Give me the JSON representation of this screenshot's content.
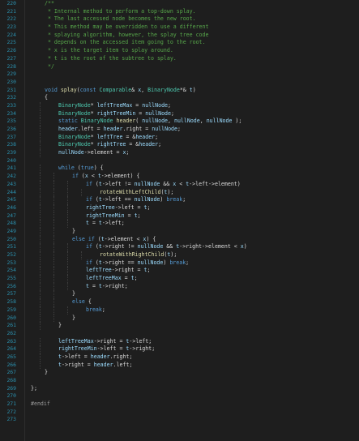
{
  "editor": {
    "first_line_number": 220,
    "colors": {
      "background": "#1e1e1e",
      "line_number": "#2b91af",
      "comment": "#57a64a",
      "keyword": "#569cd6",
      "type": "#4ec9b0",
      "function": "#dcdcaa",
      "variable": "#9cdcfe",
      "plain": "#dcdcdc"
    },
    "lines": [
      {
        "num": "220",
        "indent": 1,
        "tokens": [
          [
            "comment",
            "/**"
          ]
        ]
      },
      {
        "num": "221",
        "indent": 1,
        "tokens": [
          [
            "comment",
            " * Internal method to perform a top-down splay."
          ]
        ]
      },
      {
        "num": "222",
        "indent": 1,
        "tokens": [
          [
            "comment",
            " * The last accessed node becomes the new root."
          ]
        ]
      },
      {
        "num": "223",
        "indent": 1,
        "tokens": [
          [
            "comment",
            " * This method may be overridden to use a different"
          ]
        ]
      },
      {
        "num": "224",
        "indent": 1,
        "tokens": [
          [
            "comment",
            " * splaying algorithm, however, the splay tree code"
          ]
        ]
      },
      {
        "num": "225",
        "indent": 1,
        "tokens": [
          [
            "comment",
            " * depends on the accessed item going to the root."
          ]
        ]
      },
      {
        "num": "226",
        "indent": 1,
        "tokens": [
          [
            "comment",
            " * x is the target item to splay around."
          ]
        ]
      },
      {
        "num": "227",
        "indent": 1,
        "tokens": [
          [
            "comment",
            " * t is the root of the subtree to splay."
          ]
        ]
      },
      {
        "num": "228",
        "indent": 1,
        "tokens": [
          [
            "comment",
            " */"
          ]
        ]
      },
      {
        "num": "229",
        "indent": 0,
        "tokens": []
      },
      {
        "num": "230",
        "indent": 0,
        "tokens": []
      },
      {
        "num": "231",
        "indent": 1,
        "tokens": [
          [
            "keyword",
            "void "
          ],
          [
            "func",
            "splay"
          ],
          [
            "plain",
            "("
          ],
          [
            "keyword",
            "const "
          ],
          [
            "type",
            "Comparable"
          ],
          [
            "plain",
            "& "
          ],
          [
            "var",
            "x"
          ],
          [
            "plain",
            ", "
          ],
          [
            "type",
            "BinaryNode"
          ],
          [
            "plain",
            "*& "
          ],
          [
            "var",
            "t"
          ],
          [
            "plain",
            ")"
          ]
        ]
      },
      {
        "num": "232",
        "indent": 1,
        "tokens": [
          [
            "plain",
            "{"
          ]
        ]
      },
      {
        "num": "233",
        "indent": 2,
        "tokens": [
          [
            "type",
            "BinaryNode"
          ],
          [
            "plain",
            "* "
          ],
          [
            "var",
            "leftTreeMax"
          ],
          [
            "plain",
            " = "
          ],
          [
            "var",
            "nullNode"
          ],
          [
            "plain",
            ";"
          ]
        ]
      },
      {
        "num": "234",
        "indent": 2,
        "tokens": [
          [
            "type",
            "BinaryNode"
          ],
          [
            "plain",
            "* "
          ],
          [
            "var",
            "rightTreeMin"
          ],
          [
            "plain",
            " = "
          ],
          [
            "var",
            "nullNode"
          ],
          [
            "plain",
            ";"
          ]
        ]
      },
      {
        "num": "235",
        "indent": 2,
        "tokens": [
          [
            "keyword",
            "static "
          ],
          [
            "type",
            "BinaryNode "
          ],
          [
            "func",
            "header"
          ],
          [
            "plain",
            "( "
          ],
          [
            "var",
            "nullNode"
          ],
          [
            "plain",
            ", "
          ],
          [
            "var",
            "nullNode"
          ],
          [
            "plain",
            ", "
          ],
          [
            "var",
            "nullNode"
          ],
          [
            "plain",
            " );"
          ]
        ]
      },
      {
        "num": "236",
        "indent": 2,
        "tokens": [
          [
            "var",
            "header"
          ],
          [
            "plain",
            "."
          ],
          [
            "field",
            "left"
          ],
          [
            "plain",
            " = "
          ],
          [
            "var",
            "header"
          ],
          [
            "plain",
            "."
          ],
          [
            "field",
            "right"
          ],
          [
            "plain",
            " = "
          ],
          [
            "var",
            "nullNode"
          ],
          [
            "plain",
            ";"
          ]
        ]
      },
      {
        "num": "237",
        "indent": 2,
        "tokens": [
          [
            "type",
            "BinaryNode"
          ],
          [
            "plain",
            "* "
          ],
          [
            "var",
            "leftTree"
          ],
          [
            "plain",
            " = &"
          ],
          [
            "var",
            "header"
          ],
          [
            "plain",
            ";"
          ]
        ]
      },
      {
        "num": "238",
        "indent": 2,
        "tokens": [
          [
            "type",
            "BinaryNode"
          ],
          [
            "plain",
            "* "
          ],
          [
            "var",
            "rightTree"
          ],
          [
            "plain",
            " = &"
          ],
          [
            "var",
            "header"
          ],
          [
            "plain",
            ";"
          ]
        ]
      },
      {
        "num": "239",
        "indent": 2,
        "tokens": [
          [
            "var",
            "nullNode"
          ],
          [
            "plain",
            "->"
          ],
          [
            "field",
            "element"
          ],
          [
            "plain",
            " = "
          ],
          [
            "var",
            "x"
          ],
          [
            "plain",
            ";"
          ]
        ]
      },
      {
        "num": "240",
        "indent": 0,
        "tokens": []
      },
      {
        "num": "241",
        "indent": 2,
        "tokens": [
          [
            "keyword",
            "while "
          ],
          [
            "plain",
            "("
          ],
          [
            "keyword",
            "true"
          ],
          [
            "plain",
            ") {"
          ]
        ]
      },
      {
        "num": "242",
        "indent": 3,
        "tokens": [
          [
            "keyword",
            "if "
          ],
          [
            "plain",
            "("
          ],
          [
            "var",
            "x"
          ],
          [
            "plain",
            " < "
          ],
          [
            "var",
            "t"
          ],
          [
            "plain",
            "->"
          ],
          [
            "field",
            "element"
          ],
          [
            "plain",
            ") {"
          ]
        ]
      },
      {
        "num": "243",
        "indent": 4,
        "tokens": [
          [
            "keyword",
            "if "
          ],
          [
            "plain",
            "("
          ],
          [
            "var",
            "t"
          ],
          [
            "plain",
            "->"
          ],
          [
            "field",
            "left"
          ],
          [
            "plain",
            " != "
          ],
          [
            "var",
            "nullNode"
          ],
          [
            "plain",
            " && "
          ],
          [
            "var",
            "x"
          ],
          [
            "plain",
            " < "
          ],
          [
            "var",
            "t"
          ],
          [
            "plain",
            "->"
          ],
          [
            "field",
            "left"
          ],
          [
            "plain",
            "->"
          ],
          [
            "field",
            "element"
          ],
          [
            "plain",
            ")"
          ]
        ]
      },
      {
        "num": "244",
        "indent": 5,
        "tokens": [
          [
            "func",
            "rotateWithLeftChild"
          ],
          [
            "plain",
            "("
          ],
          [
            "var",
            "t"
          ],
          [
            "plain",
            ");"
          ]
        ]
      },
      {
        "num": "245",
        "indent": 4,
        "tokens": [
          [
            "keyword",
            "if "
          ],
          [
            "plain",
            "("
          ],
          [
            "var",
            "t"
          ],
          [
            "plain",
            "->"
          ],
          [
            "field",
            "left"
          ],
          [
            "plain",
            " == "
          ],
          [
            "var",
            "nullNode"
          ],
          [
            "plain",
            ") "
          ],
          [
            "keyword",
            "break"
          ],
          [
            "plain",
            ";"
          ]
        ]
      },
      {
        "num": "246",
        "indent": 4,
        "tokens": [
          [
            "var",
            "rightTree"
          ],
          [
            "plain",
            "->"
          ],
          [
            "field",
            "left"
          ],
          [
            "plain",
            " = "
          ],
          [
            "var",
            "t"
          ],
          [
            "plain",
            ";"
          ]
        ]
      },
      {
        "num": "247",
        "indent": 4,
        "tokens": [
          [
            "var",
            "rightTreeMin"
          ],
          [
            "plain",
            " = "
          ],
          [
            "var",
            "t"
          ],
          [
            "plain",
            ";"
          ]
        ]
      },
      {
        "num": "248",
        "indent": 4,
        "tokens": [
          [
            "var",
            "t"
          ],
          [
            "plain",
            " = "
          ],
          [
            "var",
            "t"
          ],
          [
            "plain",
            "->"
          ],
          [
            "field",
            "left"
          ],
          [
            "plain",
            ";"
          ]
        ]
      },
      {
        "num": "249",
        "indent": 3,
        "tokens": [
          [
            "plain",
            "}"
          ]
        ]
      },
      {
        "num": "250",
        "indent": 3,
        "tokens": [
          [
            "keyword",
            "else if "
          ],
          [
            "plain",
            "("
          ],
          [
            "var",
            "t"
          ],
          [
            "plain",
            "->"
          ],
          [
            "field",
            "element"
          ],
          [
            "plain",
            " < "
          ],
          [
            "var",
            "x"
          ],
          [
            "plain",
            ") {"
          ]
        ]
      },
      {
        "num": "251",
        "indent": 4,
        "tokens": [
          [
            "keyword",
            "if "
          ],
          [
            "plain",
            "("
          ],
          [
            "var",
            "t"
          ],
          [
            "plain",
            "->"
          ],
          [
            "field",
            "right"
          ],
          [
            "plain",
            " != "
          ],
          [
            "var",
            "nullNode"
          ],
          [
            "plain",
            " && "
          ],
          [
            "var",
            "t"
          ],
          [
            "plain",
            "->"
          ],
          [
            "field",
            "right"
          ],
          [
            "plain",
            "->"
          ],
          [
            "field",
            "element"
          ],
          [
            "plain",
            " < "
          ],
          [
            "var",
            "x"
          ],
          [
            "plain",
            ")"
          ]
        ]
      },
      {
        "num": "252",
        "indent": 5,
        "tokens": [
          [
            "func",
            "rotateWithRightChild"
          ],
          [
            "plain",
            "("
          ],
          [
            "var",
            "t"
          ],
          [
            "plain",
            ");"
          ]
        ]
      },
      {
        "num": "253",
        "indent": 4,
        "tokens": [
          [
            "keyword",
            "if "
          ],
          [
            "plain",
            "("
          ],
          [
            "var",
            "t"
          ],
          [
            "plain",
            "->"
          ],
          [
            "field",
            "right"
          ],
          [
            "plain",
            " == "
          ],
          [
            "var",
            "nullNode"
          ],
          [
            "plain",
            ") "
          ],
          [
            "keyword",
            "break"
          ],
          [
            "plain",
            ";"
          ]
        ]
      },
      {
        "num": "254",
        "indent": 4,
        "tokens": [
          [
            "var",
            "leftTree"
          ],
          [
            "plain",
            "->"
          ],
          [
            "field",
            "right"
          ],
          [
            "plain",
            " = "
          ],
          [
            "var",
            "t"
          ],
          [
            "plain",
            ";"
          ]
        ]
      },
      {
        "num": "255",
        "indent": 4,
        "tokens": [
          [
            "var",
            "leftTreeMax"
          ],
          [
            "plain",
            " = "
          ],
          [
            "var",
            "t"
          ],
          [
            "plain",
            ";"
          ]
        ]
      },
      {
        "num": "256",
        "indent": 4,
        "tokens": [
          [
            "var",
            "t"
          ],
          [
            "plain",
            " = "
          ],
          [
            "var",
            "t"
          ],
          [
            "plain",
            "->"
          ],
          [
            "field",
            "right"
          ],
          [
            "plain",
            ";"
          ]
        ]
      },
      {
        "num": "257",
        "indent": 3,
        "tokens": [
          [
            "plain",
            "}"
          ]
        ]
      },
      {
        "num": "258",
        "indent": 3,
        "tokens": [
          [
            "keyword",
            "else "
          ],
          [
            "plain",
            "{"
          ]
        ]
      },
      {
        "num": "259",
        "indent": 4,
        "tokens": [
          [
            "keyword",
            "break"
          ],
          [
            "plain",
            ";"
          ]
        ]
      },
      {
        "num": "260",
        "indent": 3,
        "tokens": [
          [
            "plain",
            "}"
          ]
        ]
      },
      {
        "num": "261",
        "indent": 2,
        "tokens": [
          [
            "plain",
            "}"
          ]
        ]
      },
      {
        "num": "262",
        "indent": 0,
        "tokens": []
      },
      {
        "num": "263",
        "indent": 2,
        "tokens": [
          [
            "var",
            "leftTreeMax"
          ],
          [
            "plain",
            "->"
          ],
          [
            "field",
            "right"
          ],
          [
            "plain",
            " = "
          ],
          [
            "var",
            "t"
          ],
          [
            "plain",
            "->"
          ],
          [
            "field",
            "left"
          ],
          [
            "plain",
            ";"
          ]
        ]
      },
      {
        "num": "264",
        "indent": 2,
        "tokens": [
          [
            "var",
            "rightTreeMin"
          ],
          [
            "plain",
            "->"
          ],
          [
            "field",
            "left"
          ],
          [
            "plain",
            " = "
          ],
          [
            "var",
            "t"
          ],
          [
            "plain",
            "->"
          ],
          [
            "field",
            "right"
          ],
          [
            "plain",
            ";"
          ]
        ]
      },
      {
        "num": "265",
        "indent": 2,
        "tokens": [
          [
            "var",
            "t"
          ],
          [
            "plain",
            "->"
          ],
          [
            "field",
            "left"
          ],
          [
            "plain",
            " = "
          ],
          [
            "var",
            "header"
          ],
          [
            "plain",
            "."
          ],
          [
            "field",
            "right"
          ],
          [
            "plain",
            ";"
          ]
        ]
      },
      {
        "num": "266",
        "indent": 2,
        "tokens": [
          [
            "var",
            "t"
          ],
          [
            "plain",
            "->"
          ],
          [
            "field",
            "right"
          ],
          [
            "plain",
            " = "
          ],
          [
            "var",
            "header"
          ],
          [
            "plain",
            "."
          ],
          [
            "field",
            "left"
          ],
          [
            "plain",
            ";"
          ]
        ]
      },
      {
        "num": "267",
        "indent": 1,
        "tokens": [
          [
            "plain",
            "}"
          ]
        ]
      },
      {
        "num": "268",
        "indent": 0,
        "tokens": []
      },
      {
        "num": "269",
        "indent": 0,
        "tokens": [
          [
            "plain",
            "};"
          ]
        ]
      },
      {
        "num": "270",
        "indent": 0,
        "tokens": []
      },
      {
        "num": "271",
        "indent": 0,
        "tokens": [
          [
            "pp",
            "#endif"
          ]
        ]
      },
      {
        "num": "272",
        "indent": 0,
        "tokens": []
      },
      {
        "num": "273",
        "indent": 0,
        "tokens": []
      }
    ]
  }
}
